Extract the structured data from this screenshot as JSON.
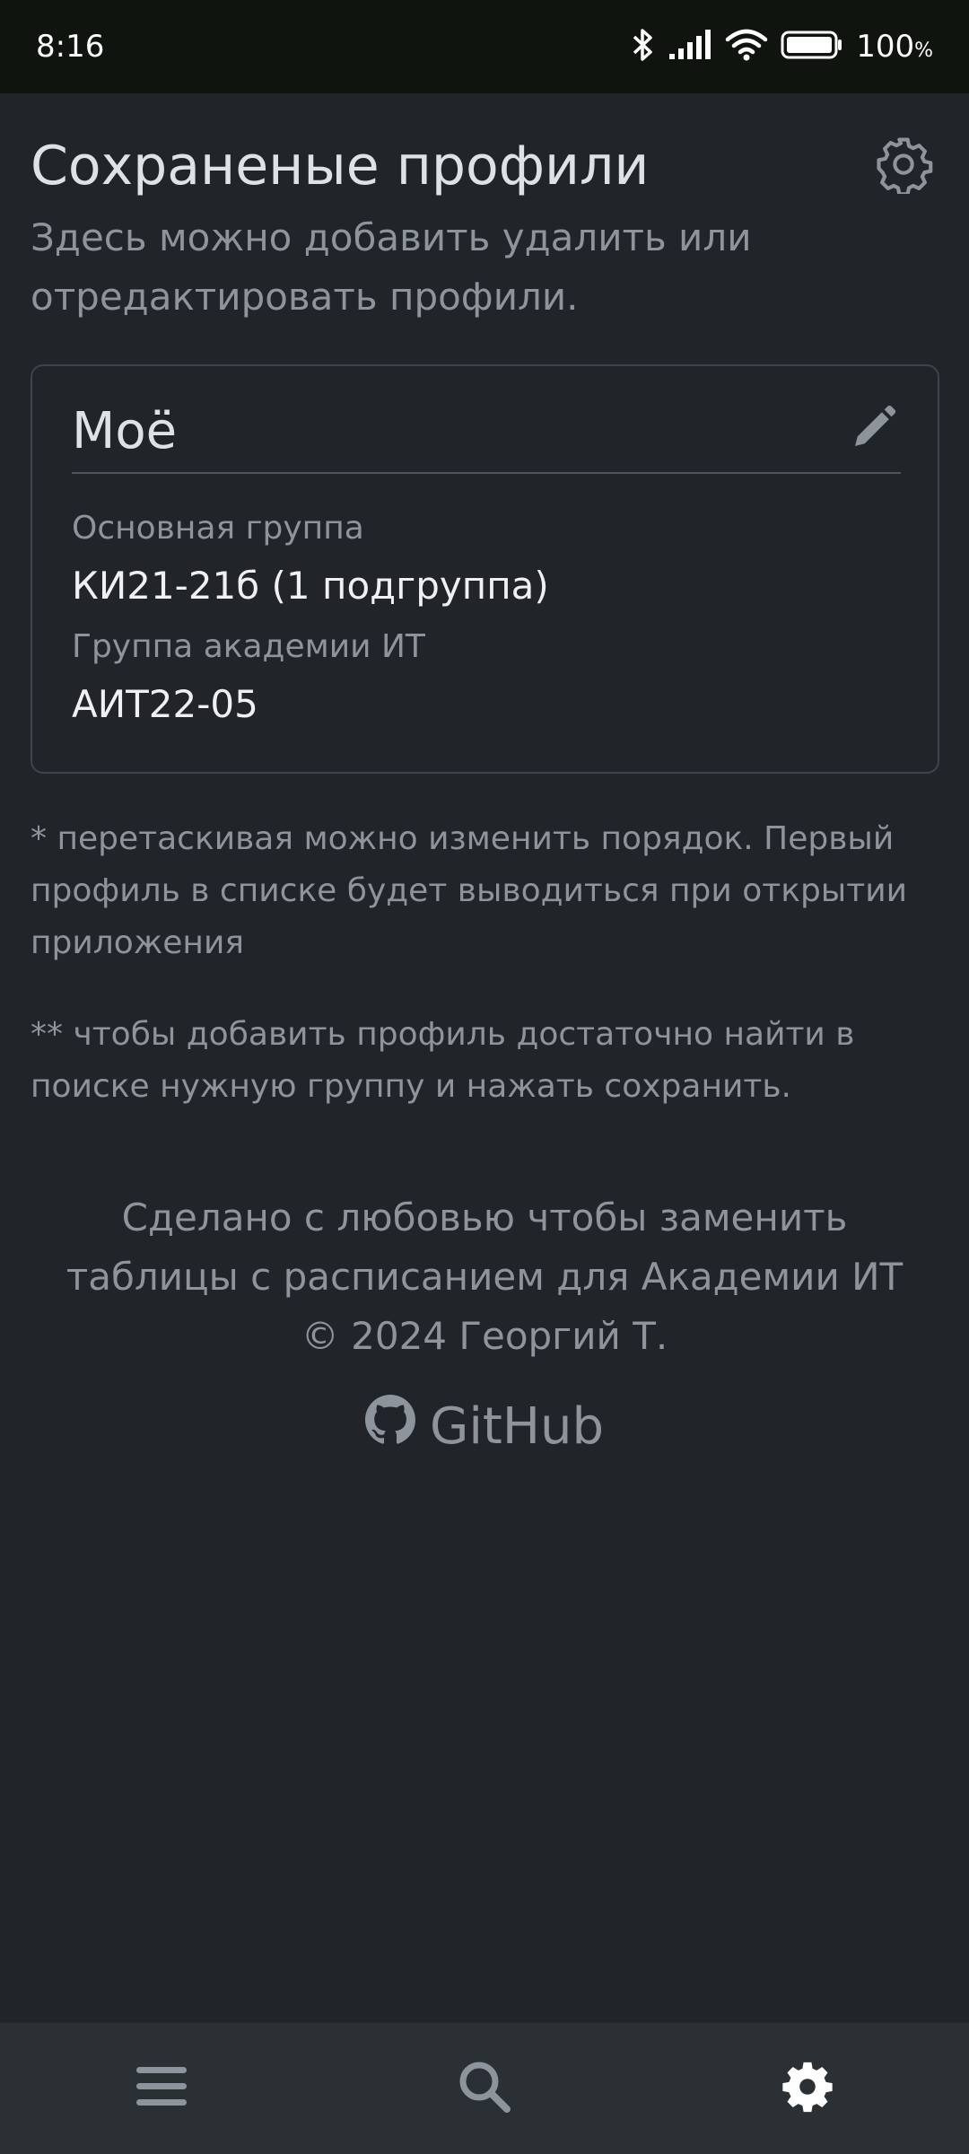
{
  "status_bar": {
    "time": "8:16",
    "battery_percent": "100",
    "battery_percent_sign": "%",
    "icons": [
      "bluetooth-icon",
      "signal-icon",
      "wifi-icon",
      "battery-icon"
    ]
  },
  "header": {
    "title": "Сохраненые профили",
    "subtitle": "Здесь можно добавить удалить или отредактировать профили.",
    "settings_icon": "gear-outline-icon"
  },
  "profile_card": {
    "name": "Моё",
    "edit_icon": "pencil-icon",
    "fields": [
      {
        "label": "Основная группа",
        "value": "КИ21-21б (1 подгруппа)"
      },
      {
        "label": "Группа академии ИТ",
        "value": "АИТ22-05"
      }
    ]
  },
  "notes": {
    "reorder": "* перетаскивая можно изменить порядок. Первый профиль в списке будет выводиться при открытии приложения",
    "add": "** чтобы добавить профиль достаточно найти в поиске нужную группу и нажать сохранить."
  },
  "footer": {
    "line1": "Сделано с любовью чтобы заменить таблицы с расписанием для Академии ИТ",
    "copyright": "© 2024 Георгий Т.",
    "github_label": "GitHub",
    "github_icon": "github-icon"
  },
  "bottom_nav": {
    "items": [
      {
        "icon": "menu-icon",
        "active": false
      },
      {
        "icon": "search-icon",
        "active": false
      },
      {
        "icon": "gear-icon",
        "active": true
      }
    ]
  },
  "colors": {
    "background": "#212429",
    "status_bar": "#0f140f",
    "bottom_nav": "#2b3035",
    "muted_text": "#8d949b",
    "primary_text": "#dee2e6"
  }
}
